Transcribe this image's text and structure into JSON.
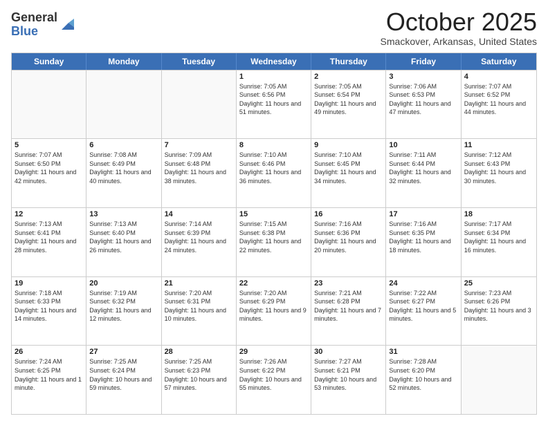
{
  "logo": {
    "general": "General",
    "blue": "Blue"
  },
  "header": {
    "month": "October 2025",
    "location": "Smackover, Arkansas, United States"
  },
  "weekdays": [
    "Sunday",
    "Monday",
    "Tuesday",
    "Wednesday",
    "Thursday",
    "Friday",
    "Saturday"
  ],
  "rows": [
    [
      {
        "day": "",
        "sunrise": "",
        "sunset": "",
        "daylight": ""
      },
      {
        "day": "",
        "sunrise": "",
        "sunset": "",
        "daylight": ""
      },
      {
        "day": "",
        "sunrise": "",
        "sunset": "",
        "daylight": ""
      },
      {
        "day": "1",
        "sunrise": "Sunrise: 7:05 AM",
        "sunset": "Sunset: 6:56 PM",
        "daylight": "Daylight: 11 hours and 51 minutes."
      },
      {
        "day": "2",
        "sunrise": "Sunrise: 7:05 AM",
        "sunset": "Sunset: 6:54 PM",
        "daylight": "Daylight: 11 hours and 49 minutes."
      },
      {
        "day": "3",
        "sunrise": "Sunrise: 7:06 AM",
        "sunset": "Sunset: 6:53 PM",
        "daylight": "Daylight: 11 hours and 47 minutes."
      },
      {
        "day": "4",
        "sunrise": "Sunrise: 7:07 AM",
        "sunset": "Sunset: 6:52 PM",
        "daylight": "Daylight: 11 hours and 44 minutes."
      }
    ],
    [
      {
        "day": "5",
        "sunrise": "Sunrise: 7:07 AM",
        "sunset": "Sunset: 6:50 PM",
        "daylight": "Daylight: 11 hours and 42 minutes."
      },
      {
        "day": "6",
        "sunrise": "Sunrise: 7:08 AM",
        "sunset": "Sunset: 6:49 PM",
        "daylight": "Daylight: 11 hours and 40 minutes."
      },
      {
        "day": "7",
        "sunrise": "Sunrise: 7:09 AM",
        "sunset": "Sunset: 6:48 PM",
        "daylight": "Daylight: 11 hours and 38 minutes."
      },
      {
        "day": "8",
        "sunrise": "Sunrise: 7:10 AM",
        "sunset": "Sunset: 6:46 PM",
        "daylight": "Daylight: 11 hours and 36 minutes."
      },
      {
        "day": "9",
        "sunrise": "Sunrise: 7:10 AM",
        "sunset": "Sunset: 6:45 PM",
        "daylight": "Daylight: 11 hours and 34 minutes."
      },
      {
        "day": "10",
        "sunrise": "Sunrise: 7:11 AM",
        "sunset": "Sunset: 6:44 PM",
        "daylight": "Daylight: 11 hours and 32 minutes."
      },
      {
        "day": "11",
        "sunrise": "Sunrise: 7:12 AM",
        "sunset": "Sunset: 6:43 PM",
        "daylight": "Daylight: 11 hours and 30 minutes."
      }
    ],
    [
      {
        "day": "12",
        "sunrise": "Sunrise: 7:13 AM",
        "sunset": "Sunset: 6:41 PM",
        "daylight": "Daylight: 11 hours and 28 minutes."
      },
      {
        "day": "13",
        "sunrise": "Sunrise: 7:13 AM",
        "sunset": "Sunset: 6:40 PM",
        "daylight": "Daylight: 11 hours and 26 minutes."
      },
      {
        "day": "14",
        "sunrise": "Sunrise: 7:14 AM",
        "sunset": "Sunset: 6:39 PM",
        "daylight": "Daylight: 11 hours and 24 minutes."
      },
      {
        "day": "15",
        "sunrise": "Sunrise: 7:15 AM",
        "sunset": "Sunset: 6:38 PM",
        "daylight": "Daylight: 11 hours and 22 minutes."
      },
      {
        "day": "16",
        "sunrise": "Sunrise: 7:16 AM",
        "sunset": "Sunset: 6:36 PM",
        "daylight": "Daylight: 11 hours and 20 minutes."
      },
      {
        "day": "17",
        "sunrise": "Sunrise: 7:16 AM",
        "sunset": "Sunset: 6:35 PM",
        "daylight": "Daylight: 11 hours and 18 minutes."
      },
      {
        "day": "18",
        "sunrise": "Sunrise: 7:17 AM",
        "sunset": "Sunset: 6:34 PM",
        "daylight": "Daylight: 11 hours and 16 minutes."
      }
    ],
    [
      {
        "day": "19",
        "sunrise": "Sunrise: 7:18 AM",
        "sunset": "Sunset: 6:33 PM",
        "daylight": "Daylight: 11 hours and 14 minutes."
      },
      {
        "day": "20",
        "sunrise": "Sunrise: 7:19 AM",
        "sunset": "Sunset: 6:32 PM",
        "daylight": "Daylight: 11 hours and 12 minutes."
      },
      {
        "day": "21",
        "sunrise": "Sunrise: 7:20 AM",
        "sunset": "Sunset: 6:31 PM",
        "daylight": "Daylight: 11 hours and 10 minutes."
      },
      {
        "day": "22",
        "sunrise": "Sunrise: 7:20 AM",
        "sunset": "Sunset: 6:29 PM",
        "daylight": "Daylight: 11 hours and 9 minutes."
      },
      {
        "day": "23",
        "sunrise": "Sunrise: 7:21 AM",
        "sunset": "Sunset: 6:28 PM",
        "daylight": "Daylight: 11 hours and 7 minutes."
      },
      {
        "day": "24",
        "sunrise": "Sunrise: 7:22 AM",
        "sunset": "Sunset: 6:27 PM",
        "daylight": "Daylight: 11 hours and 5 minutes."
      },
      {
        "day": "25",
        "sunrise": "Sunrise: 7:23 AM",
        "sunset": "Sunset: 6:26 PM",
        "daylight": "Daylight: 11 hours and 3 minutes."
      }
    ],
    [
      {
        "day": "26",
        "sunrise": "Sunrise: 7:24 AM",
        "sunset": "Sunset: 6:25 PM",
        "daylight": "Daylight: 11 hours and 1 minute."
      },
      {
        "day": "27",
        "sunrise": "Sunrise: 7:25 AM",
        "sunset": "Sunset: 6:24 PM",
        "daylight": "Daylight: 10 hours and 59 minutes."
      },
      {
        "day": "28",
        "sunrise": "Sunrise: 7:25 AM",
        "sunset": "Sunset: 6:23 PM",
        "daylight": "Daylight: 10 hours and 57 minutes."
      },
      {
        "day": "29",
        "sunrise": "Sunrise: 7:26 AM",
        "sunset": "Sunset: 6:22 PM",
        "daylight": "Daylight: 10 hours and 55 minutes."
      },
      {
        "day": "30",
        "sunrise": "Sunrise: 7:27 AM",
        "sunset": "Sunset: 6:21 PM",
        "daylight": "Daylight: 10 hours and 53 minutes."
      },
      {
        "day": "31",
        "sunrise": "Sunrise: 7:28 AM",
        "sunset": "Sunset: 6:20 PM",
        "daylight": "Daylight: 10 hours and 52 minutes."
      },
      {
        "day": "",
        "sunrise": "",
        "sunset": "",
        "daylight": ""
      }
    ]
  ]
}
